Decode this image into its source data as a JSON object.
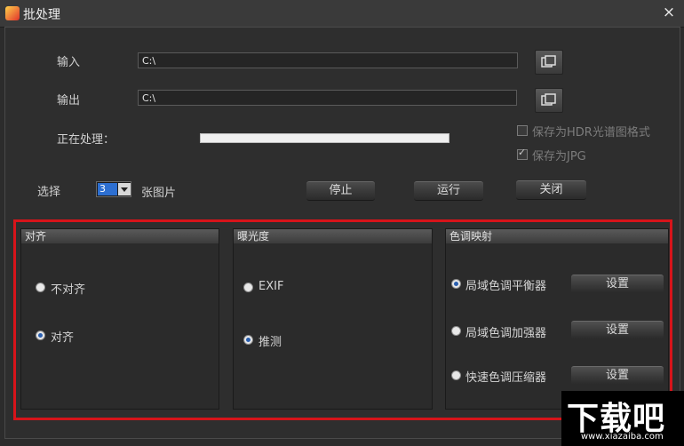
{
  "window": {
    "title": "批处理",
    "close_glyph": "×"
  },
  "io": {
    "input_label": "输入",
    "input_value": "C:\\",
    "output_label": "输出",
    "output_value": "C:\\"
  },
  "processing": {
    "label": "正在处理：",
    "progress": 1.0
  },
  "options": {
    "save_hdr_label": "保存为HDR光谱图格式",
    "save_hdr_checked": false,
    "save_jpg_label": "保存为JPG",
    "save_jpg_checked": true
  },
  "selection": {
    "label": "选择",
    "count": "3",
    "suffix": "张图片"
  },
  "buttons": {
    "stop": "停止",
    "run": "运行",
    "close": "关闭"
  },
  "panels": {
    "align": {
      "title": "对齐",
      "opt_no": "不对齐",
      "opt_yes": "对齐",
      "selected": "对齐"
    },
    "exposure": {
      "title": "曝光度",
      "opt_exif": "EXIF",
      "opt_guess": "推测",
      "selected": "推测"
    },
    "tonemap": {
      "title": "色调映射",
      "opt_local_balance": "局域色调平衡器",
      "opt_local_enhance": "局域色调加强器",
      "opt_fast_compress": "快速色调压缩器",
      "setting_label": "设置",
      "selected": "局域色调平衡器"
    }
  },
  "watermark": {
    "main": "下载吧",
    "sub": "www.xiazaiba.com"
  },
  "colors": {
    "highlight": "#d7141a",
    "accent": "#2d6fd1"
  }
}
